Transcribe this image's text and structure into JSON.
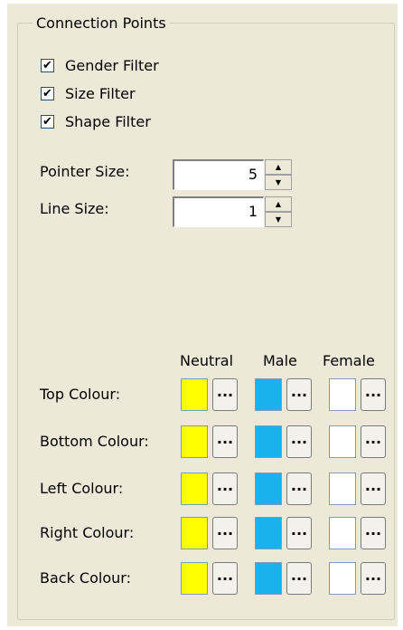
{
  "group": {
    "title": "Connection Points"
  },
  "filters": [
    {
      "label": "Gender Filter",
      "checked": true
    },
    {
      "label": "Size Filter",
      "checked": true
    },
    {
      "label": "Shape Filter",
      "checked": true
    }
  ],
  "pointer_size": {
    "label": "Pointer Size:",
    "value": "5"
  },
  "line_size": {
    "label": "Line Size:",
    "value": "1"
  },
  "columns": [
    "Neutral",
    "Male",
    "Female"
  ],
  "colours": {
    "neutral": "#ffff00",
    "male": "#1ab2ee",
    "female": "#ffffff"
  },
  "button_label": "...",
  "rows": [
    {
      "label": "Top Colour:"
    },
    {
      "label": "Bottom Colour:"
    },
    {
      "label": "Left Colour:"
    },
    {
      "label": "Right Colour:"
    },
    {
      "label": "Back Colour:"
    }
  ]
}
